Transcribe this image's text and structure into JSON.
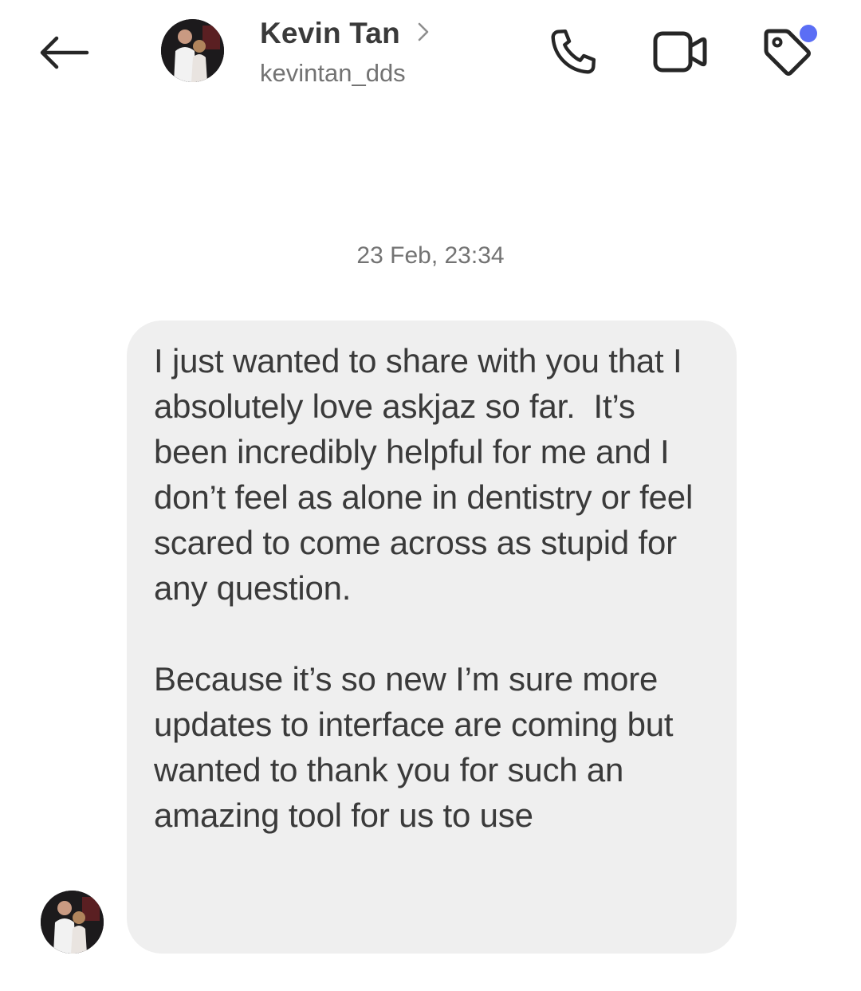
{
  "header": {
    "back_icon": "arrow-left-icon",
    "contact_name": "Kevin Tan",
    "chevron_icon": "chevron-right-icon",
    "username": "kevintan_dds",
    "call_icon": "phone-icon",
    "video_icon": "video-camera-icon",
    "tag_icon": "tag-icon",
    "tag_has_notification": true,
    "notification_dot_color": "#5b6ef5"
  },
  "thread": {
    "timestamp": "23 Feb, 23:34",
    "message": {
      "paragraphs": [
        "I just wanted to share with you that I absolutely love askjaz so far.  It’s been incredibly helpful for me and I don’t feel as alone in dentistry or feel scared to come across as stupid for any question.",
        "Because it’s so new I’m sure more updates to interface are coming but wanted to thank you for such an amazing tool for us to use"
      ],
      "bubble_color": "#efefef"
    }
  }
}
